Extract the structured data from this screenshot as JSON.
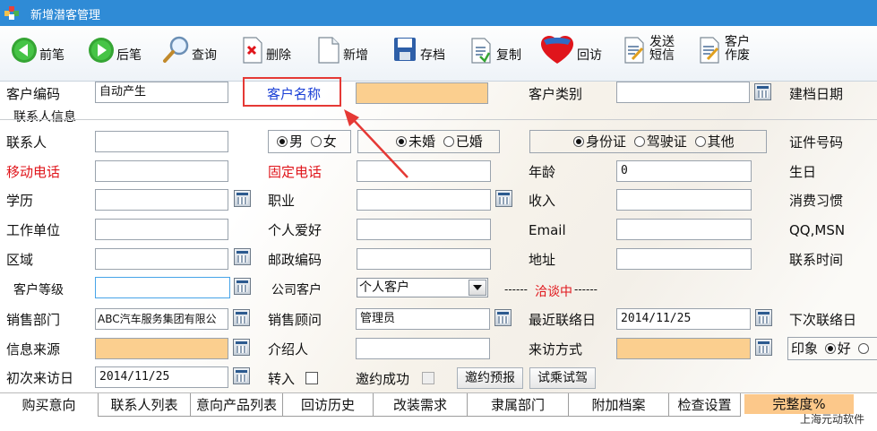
{
  "window": {
    "title": "新增潜客管理"
  },
  "toolbar": {
    "prev": "前笔",
    "next": "后笔",
    "query": "查询",
    "delete": "删除",
    "new": "新增",
    "save": "存档",
    "copy": "复制",
    "revisit": "回访",
    "sms_line1": "发送",
    "sms_line2": "短信",
    "work_line1": "客户",
    "work_line2": "作废"
  },
  "form": {
    "customer_code_label": "客户编码",
    "customer_code_value": "自动产生",
    "customer_name_label": "客户名称",
    "customer_name_value": "",
    "customer_type_label": "客户类别",
    "customer_type_value": "",
    "create_date_label": "建档日期",
    "contact_group_label": "联系人信息",
    "contact_label": "联系人",
    "contact_value": "",
    "gender_male": "男",
    "gender_female": "女",
    "marital_single": "未婚",
    "marital_married": "已婚",
    "id_type_idcard": "身份证",
    "id_type_license": "驾驶证",
    "id_type_other": "其他",
    "id_no_label": "证件号码",
    "mobile_label": "移动电话",
    "mobile_value": "",
    "phone_label": "固定电话",
    "phone_value": "",
    "age_label": "年龄",
    "age_value": "0",
    "birthday_label": "生日",
    "education_label": "学历",
    "education_value": "",
    "job_label": "职业",
    "job_value": "",
    "income_label": "收入",
    "income_value": "",
    "habit_label": "消费习惯",
    "employer_label": "工作单位",
    "employer_value": "",
    "hobby_label": "个人爱好",
    "hobby_value": "",
    "email_label": "Email",
    "email_value": "",
    "qq_label": "QQ,MSN",
    "region_label": "区域",
    "region_value": "",
    "postcode_label": "邮政编码",
    "postcode_value": "",
    "address_label": "地址",
    "address_value": "",
    "contact_time_label": "联系时间",
    "grade_label": "客户等级",
    "grade_value": "",
    "company_customer_label": "公司客户",
    "company_customer_select": "个人客户",
    "status_dash_left": "------",
    "status_text": "洽谈中",
    "status_dash_right": "------",
    "dept_label": "销售部门",
    "dept_value": "ABC汽车服务集团有限公",
    "advisor_label": "销售顾问",
    "advisor_value": "管理员",
    "last_contact_label": "最近联络日",
    "last_contact_value": "2014/11/25",
    "next_contact_label": "下次联络日",
    "source_label": "信息来源",
    "source_value": "",
    "referrer_label": "介绍人",
    "referrer_value": "",
    "visit_mode_label": "来访方式",
    "visit_mode_value": "",
    "impression_label": "印象",
    "impression_good": "好",
    "first_visit_label": "初次来访日",
    "first_visit_value": "2014/11/25",
    "transfer_label": "转入",
    "invite_success_label": "邀约成功",
    "invite_btn": "邀约预报",
    "test_drive_btn": "试乘试驾"
  },
  "tabs": [
    "购买意向",
    "联系人列表",
    "意向产品列表",
    "回访历史",
    "改装需求",
    "隶属部门",
    "附加档案",
    "检查设置"
  ],
  "completeness_label": "完整度%",
  "brand": "上海元动软件",
  "colors": {
    "title_bar": "#2f8bd6",
    "required_label": "#e0151b",
    "highlight_box": "#e53935",
    "required_input": "#fbcf8f"
  }
}
